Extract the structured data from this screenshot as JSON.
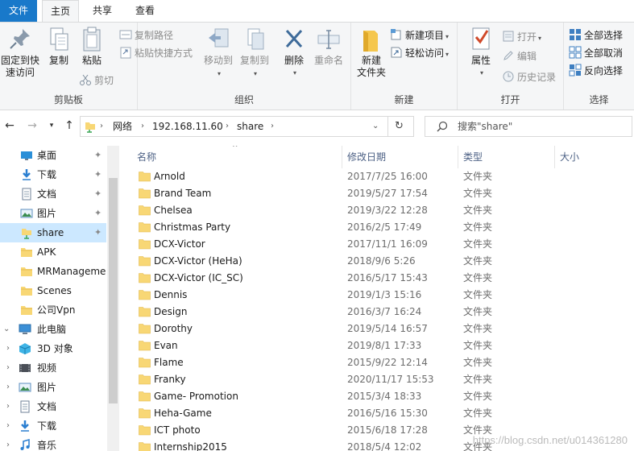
{
  "tabs": {
    "file": "文件",
    "home": "主页",
    "share": "共享",
    "view": "查看"
  },
  "ribbon": {
    "clipboard": {
      "label": "剪贴板",
      "pin": "固定到快\n速访问",
      "copy": "复制",
      "paste": "粘贴",
      "copy_path": "复制路径",
      "paste_shortcut": "粘贴快捷方式",
      "cut": "剪切"
    },
    "organize": {
      "label": "组织",
      "move_to": "移动到",
      "copy_to": "复制到",
      "delete": "删除",
      "rename": "重命名"
    },
    "new": {
      "label": "新建",
      "new_folder": "新建\n文件夹",
      "new_item": "新建项目",
      "easy_access": "轻松访问"
    },
    "open": {
      "label": "打开",
      "properties": "属性",
      "open": "打开",
      "edit": "编辑",
      "history": "历史记录"
    },
    "select": {
      "label": "选择",
      "select_all": "全部选择",
      "select_none": "全部取消",
      "invert": "反向选择"
    }
  },
  "address": {
    "crumbs": [
      "网络",
      "192.168.11.60",
      "share"
    ],
    "search_placeholder": "搜索\"share\""
  },
  "nav": {
    "items": [
      {
        "label": "桌面",
        "icon": "desktop-icon",
        "pinned": true
      },
      {
        "label": "下载",
        "icon": "download-arrow-icon",
        "pinned": true
      },
      {
        "label": "文档",
        "icon": "document-icon",
        "pinned": true
      },
      {
        "label": "图片",
        "icon": "picture-icon",
        "pinned": true
      },
      {
        "label": "share",
        "icon": "network-folder-icon",
        "pinned": true,
        "selected": true
      },
      {
        "label": "APK",
        "icon": "folder-icon"
      },
      {
        "label": "MRManageme",
        "icon": "folder-icon"
      },
      {
        "label": "Scenes",
        "icon": "folder-icon"
      },
      {
        "label": "公司Vpn",
        "icon": "folder-icon"
      },
      {
        "label": "此电脑",
        "icon": "computer-icon",
        "expanded": true
      },
      {
        "label": "3D 对象",
        "icon": "3d-objects-icon",
        "collapsed": true
      },
      {
        "label": "视频",
        "icon": "video-icon",
        "collapsed": true
      },
      {
        "label": "图片",
        "icon": "picture-icon",
        "collapsed": true
      },
      {
        "label": "文档",
        "icon": "document-icon",
        "collapsed": true
      },
      {
        "label": "下载",
        "icon": "download-arrow-icon",
        "collapsed": true
      },
      {
        "label": "音乐",
        "icon": "music-icon",
        "collapsed": true
      }
    ]
  },
  "columns": {
    "name": "名称",
    "date": "修改日期",
    "type": "类型",
    "size": "大小"
  },
  "files": [
    {
      "name": "Arnold",
      "date": "2017/7/25 16:00",
      "type": "文件夹"
    },
    {
      "name": "Brand Team",
      "date": "2019/5/27 17:54",
      "type": "文件夹"
    },
    {
      "name": "Chelsea",
      "date": "2019/3/22 12:28",
      "type": "文件夹"
    },
    {
      "name": "Christmas Party",
      "date": "2016/2/5 17:49",
      "type": "文件夹"
    },
    {
      "name": "DCX-Victor",
      "date": "2017/11/1 16:09",
      "type": "文件夹"
    },
    {
      "name": "DCX-Victor (HeHa)",
      "date": "2018/9/6 5:26",
      "type": "文件夹"
    },
    {
      "name": "DCX-Victor (IC_SC)",
      "date": "2016/5/17 15:43",
      "type": "文件夹"
    },
    {
      "name": "Dennis",
      "date": "2019/1/3 15:16",
      "type": "文件夹"
    },
    {
      "name": "Design",
      "date": "2016/3/7 16:24",
      "type": "文件夹"
    },
    {
      "name": "Dorothy",
      "date": "2019/5/14 16:57",
      "type": "文件夹"
    },
    {
      "name": "Evan",
      "date": "2019/8/1 17:33",
      "type": "文件夹"
    },
    {
      "name": "Flame",
      "date": "2015/9/22 12:14",
      "type": "文件夹"
    },
    {
      "name": "Franky",
      "date": "2020/11/17 15:53",
      "type": "文件夹"
    },
    {
      "name": "Game- Promotion",
      "date": "2015/3/4 18:33",
      "type": "文件夹"
    },
    {
      "name": "Heha-Game",
      "date": "2016/5/16 15:30",
      "type": "文件夹"
    },
    {
      "name": "ICT photo",
      "date": "2015/6/18 17:28",
      "type": "文件夹"
    },
    {
      "name": "Internship2015",
      "date": "2018/5/4 12:02",
      "type": "文件夹"
    }
  ],
  "watermark": "https://blog.csdn.net/u014361280",
  "colors": {
    "file_tab": "#1979ca",
    "selected": "#cce8ff",
    "folder": "#f8d775",
    "header_text": "#4d6185"
  }
}
